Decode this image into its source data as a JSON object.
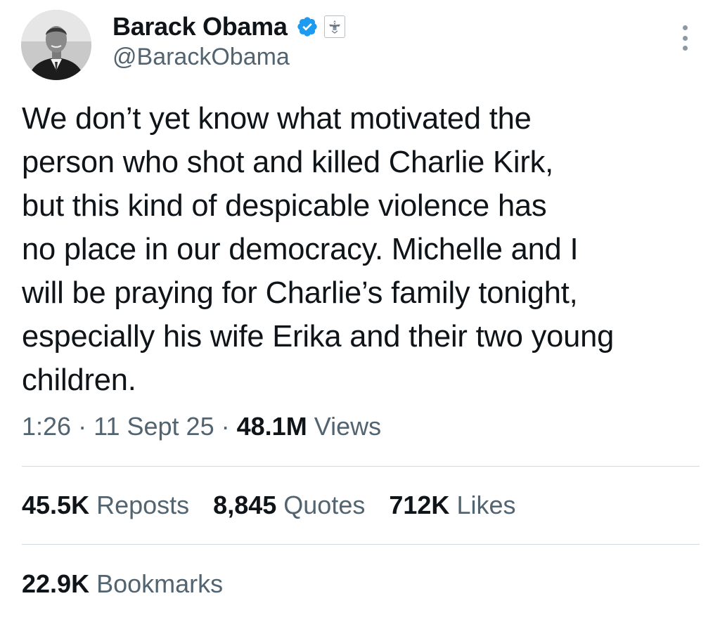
{
  "author": {
    "display_name": "Barack Obama",
    "handle": "@BarackObama",
    "verified": true,
    "affiliate_badge": "us-government-seal-icon"
  },
  "tweet": {
    "text": "We don’t yet know what motivated the\nperson who shot and killed Charlie Kirk,\nbut this kind of despicable violence has\nno place in our democracy. Michelle and I\nwill be praying for Charlie’s family tonight,\nespecially his wife Erika and their two young\nchildren."
  },
  "meta": {
    "time": "1:26",
    "separator": "·",
    "date": "11 Sept 25",
    "views_count": "48.1M",
    "views_label": "Views"
  },
  "stats": [
    {
      "count": "45.5K",
      "label": "Reposts"
    },
    {
      "count": "8,845",
      "label": "Quotes"
    },
    {
      "count": "712K",
      "label": "Likes"
    }
  ],
  "bookmarks": {
    "count": "22.9K",
    "label": "Bookmarks"
  },
  "colors": {
    "text_primary": "#0f1419",
    "text_secondary": "#536471",
    "verified_blue": "#1d9bf0",
    "divider": "#cfd9de"
  },
  "icons": {
    "more": "more-vertical-icon",
    "verified": "verified-badge-icon"
  }
}
